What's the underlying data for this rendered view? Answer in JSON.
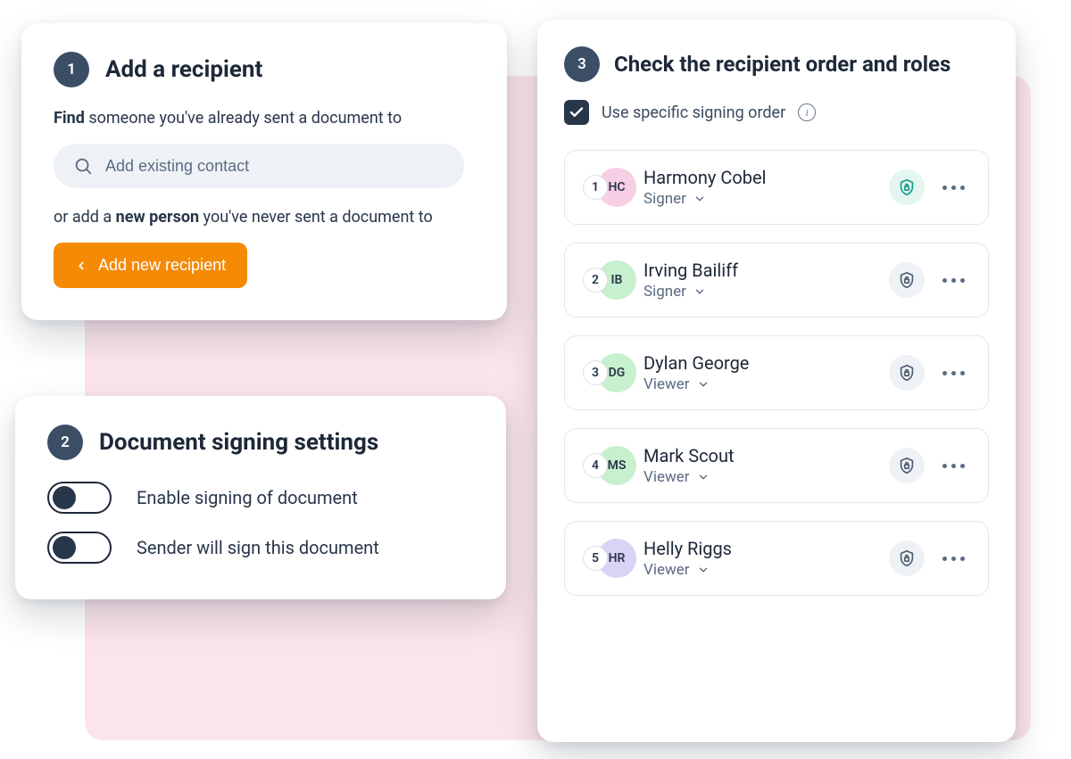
{
  "step1": {
    "num": "1",
    "title": "Add a recipient",
    "find_pre": "Find",
    "find_rest": " someone you've already sent a document to",
    "search_placeholder": "Add existing contact",
    "or_pre": "or add a ",
    "or_mid": "new person",
    "or_rest": " you've never sent a document to",
    "button": "Add new recipient"
  },
  "step2": {
    "num": "2",
    "title": "Document signing settings",
    "toggle1": "Enable signing of document",
    "toggle2": "Sender will sign this document"
  },
  "step3": {
    "num": "3",
    "title": "Check the recipient order and roles",
    "order_label": "Use specific signing order",
    "recipients": [
      {
        "order": "1",
        "initials": "HC",
        "name": "Harmony Cobel",
        "role": "Signer",
        "color": "#f7cfe4",
        "lock_active": true
      },
      {
        "order": "2",
        "initials": "IB",
        "name": "Irving Bailiff",
        "role": "Signer",
        "color": "#c7f0cf",
        "lock_active": false
      },
      {
        "order": "3",
        "initials": "DG",
        "name": "Dylan George",
        "role": "Viewer",
        "color": "#c7f0cf",
        "lock_active": false
      },
      {
        "order": "4",
        "initials": "MS",
        "name": "Mark Scout",
        "role": "Viewer",
        "color": "#c7f0cf",
        "lock_active": false
      },
      {
        "order": "5",
        "initials": "HR",
        "name": "Helly Riggs",
        "role": "Viewer",
        "color": "#d9d3f5",
        "lock_active": false
      }
    ]
  },
  "colors": {
    "dark": "#28364a",
    "orange": "#f58a07",
    "teal": "#0f9d84"
  }
}
